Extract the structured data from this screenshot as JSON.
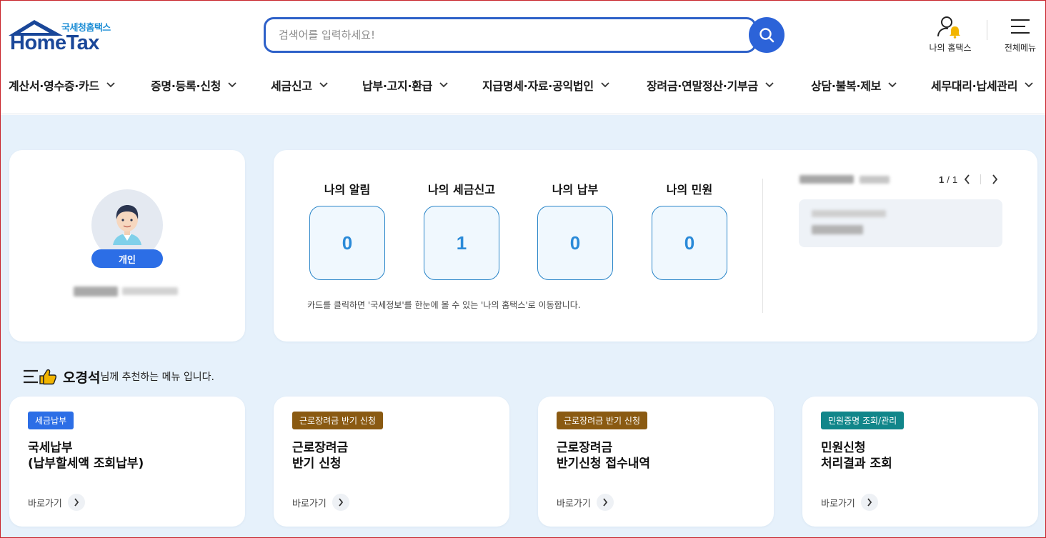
{
  "header": {
    "logo_sub": "국세청홈택스",
    "logo_main": "HomeTax",
    "search_placeholder": "검색어를 입력하세요!",
    "my_hometax": "나의 홈택스",
    "all_menu": "전체메뉴"
  },
  "nav": [
    {
      "label": "계산서·영수증·카드"
    },
    {
      "label": "증명·등록·신청"
    },
    {
      "label": "세금신고"
    },
    {
      "label": "납부·고지·환급"
    },
    {
      "label": "지급명세·자료·공익법인"
    },
    {
      "label": "장려금·연말정산·기부금"
    },
    {
      "label": "상담·불복·제보"
    },
    {
      "label": "세무대리·납세관리"
    }
  ],
  "profile": {
    "badge": "개인"
  },
  "summary": {
    "stats": [
      {
        "title": "나의 알림",
        "value": "0"
      },
      {
        "title": "나의 세금신고",
        "value": "1"
      },
      {
        "title": "나의 납부",
        "value": "0"
      },
      {
        "title": "나의 민원",
        "value": "0"
      }
    ],
    "note": "카드를 클릭하면 '국세정보'를 한눈에 볼 수 있는 '나의 홈택스'로 이동합니다.",
    "pager": {
      "current": "1",
      "sep": "/",
      "total": "1"
    }
  },
  "recommend": {
    "user_name": "오경석",
    "suffix": "님께 추천하는 메뉴 입니다.",
    "cards": [
      {
        "tag": "세금납부",
        "tag_color": "#2c6ee6",
        "line1": "국세납부",
        "line2": "(납부할세액 조회납부)",
        "go": "바로가기"
      },
      {
        "tag": "근로장려금 반기 신청",
        "tag_color": "#8a5a12",
        "line1": "근로장려금",
        "line2": "반기 신청",
        "go": "바로가기"
      },
      {
        "tag": "근로장려금 반기 신청",
        "tag_color": "#8a5a12",
        "line1": "근로장려금",
        "line2": "반기신청 접수내역",
        "go": "바로가기"
      },
      {
        "tag": "민원증명 조회/관리",
        "tag_color": "#11868a",
        "line1": "민원신청",
        "line2": "처리결과 조회",
        "go": "바로가기"
      }
    ]
  },
  "colors": {
    "accent": "#2c63d8",
    "nav_text": "#1a1a1a",
    "stat_value": "#2a8ad8",
    "body_bg": "#e6f1fb"
  }
}
